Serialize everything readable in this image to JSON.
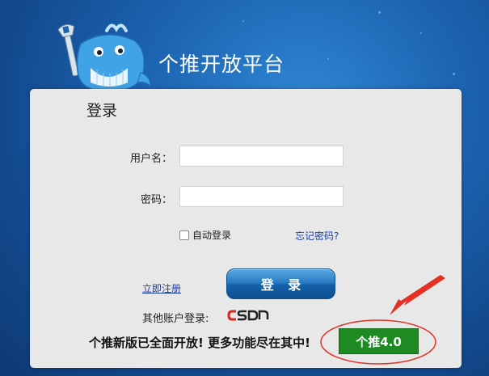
{
  "brand": {
    "title": "个推开放平台",
    "mascot_icon": "whale-mascot-icon"
  },
  "login": {
    "heading": "登录",
    "username_label": "用户名：",
    "username_value": "",
    "password_label": "密码：",
    "password_value": "",
    "remember_label": "自动登录",
    "remember_checked": false,
    "forgot_link": "忘记密码?",
    "register_link": "立即注册",
    "submit_label": "登 录"
  },
  "other_accounts": {
    "label": "其他账户登录:",
    "providers": [
      "CSDN"
    ]
  },
  "promo": {
    "text": "个推新版已全面开放! 更多功能尽在其中!",
    "button_label": "个推4.0"
  },
  "colors": {
    "background": "#1c63b0",
    "panel": "#e8e8e8",
    "login_button": "#1e6db8",
    "promo_button": "#1e8a22",
    "annotation": "#e53025",
    "csdn_red": "#d9251b"
  }
}
